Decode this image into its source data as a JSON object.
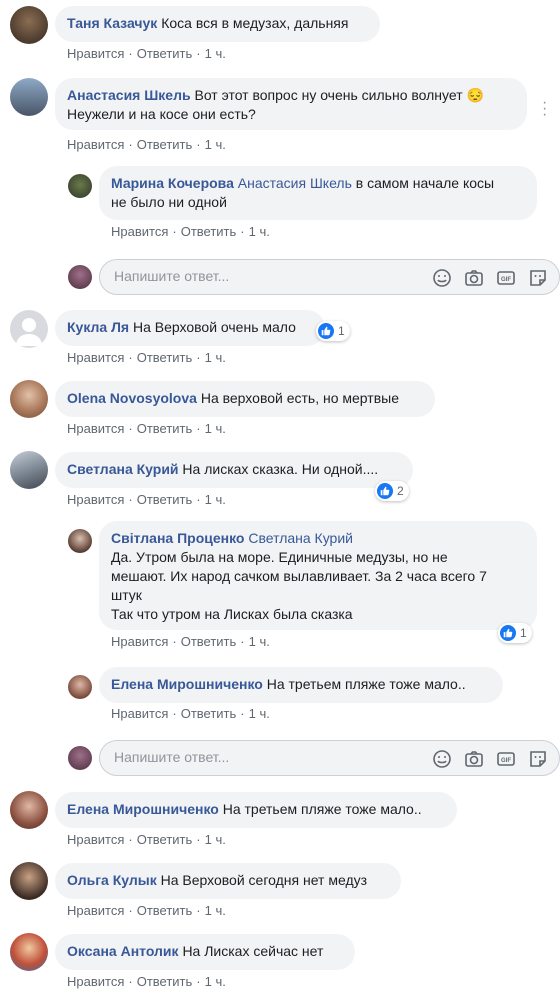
{
  "actions": {
    "like": "Нравится",
    "reply": "Ответить",
    "sep": "·",
    "time": "1 ч."
  },
  "reply_box": {
    "placeholder": "Напишите ответ..."
  },
  "colors": {
    "link": "#385898",
    "bubble": "#f2f3f5",
    "like_blue": "#1877f2"
  },
  "comments": [
    {
      "author": "Таня Казачук",
      "text": "Коса вся в медузах, дальняя"
    },
    {
      "author": "Анастасия Шкель",
      "text_line1": "Вот этот вопрос ну очень сильно волнует",
      "emoji": "😔",
      "text_line2": "Неужели и на косе они есть?",
      "reply": {
        "author": "Марина Кочерова",
        "mention": "Анастасия Шкель",
        "text_line1": "в самом начале косы",
        "text_line2": "не было ни одной"
      }
    },
    {
      "author": "Кукла Ля",
      "text": "На Верховой очень мало",
      "likes": "1"
    },
    {
      "author": "Olena Novosyolova",
      "text": "На верховой есть, но мертвые"
    },
    {
      "author": "Светлана Курий",
      "text": "На лисках сказка. Ни одной....",
      "likes": "2",
      "reply1": {
        "author": "Світлана Проценко",
        "mention": "Светлана Курий",
        "line1": "Да. Утром была на море. Единичные медузы, но не",
        "line2": "мешают. Их народ сачком вылавливает. За 2 часа всего 7",
        "line3": "штук",
        "line4": "Так что утром на Лисках была сказка",
        "likes": "1"
      },
      "reply2": {
        "author": "Елена Мирошниченко",
        "text": "На третьем пляже тоже мало.."
      }
    },
    {
      "author": "Елена Мирошниченко",
      "text": "На третьем пляже тоже мало.."
    },
    {
      "author": "Ольга Кулык",
      "text": "На Верховой сегодня нет медуз"
    },
    {
      "author": "Оксана Антолик",
      "text": "На Лисках сейчас нет"
    }
  ]
}
